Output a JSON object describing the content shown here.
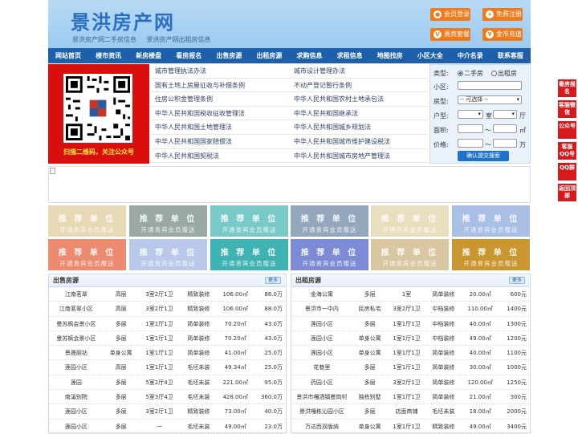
{
  "header": {
    "logo": "景洪房产网",
    "sub_links": [
      "景洪房产网二手房信息",
      "景洪房产网出租房信息"
    ],
    "buttons": [
      {
        "label": "会员登录",
        "icon": "user-icon"
      },
      {
        "label": "免费注册",
        "icon": "register-icon"
      },
      {
        "label": "贵宾套餐",
        "icon": "vip-icon"
      },
      {
        "label": "金币充值",
        "icon": "coin-icon"
      }
    ]
  },
  "nav": [
    "网站首页",
    "楼市资讯",
    "新房楼盘",
    "看房报名",
    "出售房源",
    "出租房源",
    "求购信息",
    "求租信息",
    "地图找房",
    "小区大全",
    "中介名录",
    "联系客服"
  ],
  "qr": {
    "caption": "扫描二维码，关注公众号"
  },
  "laws": [
    [
      "城市管理执法办法",
      "城市设计管理办法"
    ],
    [
      "国有土地上房屋征收与补偿条例",
      "不动产登记暂行条例"
    ],
    [
      "住房公积金管理条例",
      "中华人民共和国农村土地承包法"
    ],
    [
      "中华人民共和国税收征收管理法",
      "中华人民共和国继承法"
    ],
    [
      "中华人民共和国土地管理法",
      "中华人民共和国城乡规划法"
    ],
    [
      "中华人民共和国国家赔偿法",
      "中华人民共和国城市维护建设税法"
    ],
    [
      "中华人民共和国契税法",
      "中华人民共和国城市房地产管理法"
    ]
  ],
  "search": {
    "type_label": "类型:",
    "type_options": [
      "二手房",
      "出租房"
    ],
    "district_label": "小区:",
    "housetype_label": "房型:",
    "housetype_value": "-- 可选择 --",
    "layout_label": "户型:",
    "room_unit": "室",
    "hall_unit": "厅",
    "area_label": "面积:",
    "area_sep": "～",
    "area_unit": "㎡",
    "price_label": "价格:",
    "price_sep": "～",
    "price_unit": "万",
    "submit_label": "确认提交搜索"
  },
  "ads": {
    "title": "推 荐 单 位",
    "subtitle": "开通贵宾会员赠送",
    "colors": [
      "#e6d9b3",
      "#9aa8a6",
      "#7ac9c9",
      "#95a7bd",
      "#e9dfbf",
      "#a9bfe6",
      "#ee8a6f",
      "#b9c9ec",
      "#3fb3b3",
      "#7d8bd6",
      "#d9c7a1",
      "#c9962f"
    ]
  },
  "sale": {
    "title": "出售房源",
    "more": "更多",
    "rows": [
      [
        "江南茗翠",
        "高层",
        "3室2厅1卫",
        "精致装修",
        "106.00㎡",
        "88.0万"
      ],
      [
        "江南茗翠小区",
        "高层",
        "3室2厅1卫",
        "精致装修",
        "106.00㎡",
        "88.0万"
      ],
      [
        "曼苏枫会景小区",
        "多层",
        "1室1厅1卫",
        "简单装修",
        "70.20㎡",
        "43.0万"
      ],
      [
        "曼苏枫会景小区",
        "多层",
        "1室1厅1卫",
        "简单装修",
        "70.20㎡",
        "43.0万"
      ],
      [
        "景晟丽钻",
        "单身公寓",
        "1室1厅1卫",
        "简单装修",
        "41.00㎡",
        "25.0万"
      ],
      [
        "莲园小区",
        "高层",
        "1室1厅1卫",
        "毛坯未装",
        "49.34㎡",
        "25.0万"
      ],
      [
        "莲园",
        "多层",
        "5室2厅4卫",
        "毛坯未装",
        "221.00㎡",
        "95.0万"
      ],
      [
        "南溪别院",
        "多层",
        "5室3厅4卫",
        "毛坯未装",
        "428.00㎡",
        "360.0万"
      ],
      [
        "莲园小区",
        "多层",
        "3室2厅1卫",
        "精致装修",
        "73.00㎡",
        "40.0万"
      ],
      [
        "莲园小区",
        "多层",
        "一",
        "毛坯未装",
        "49.00㎡",
        "23.0万"
      ]
    ]
  },
  "rent": {
    "title": "出租房源",
    "more": "更多",
    "rows": [
      [
        "金海公寓",
        "多层",
        "1室",
        "简单装修",
        "20.00㎡",
        "600元"
      ],
      [
        "景洪市一中内",
        "民房私宅",
        "3室2厅1卫",
        "中档装修",
        "110.00㎡",
        "1400元"
      ],
      [
        "莲园小区",
        "多层",
        "1室1厅1卫",
        "中档装修",
        "40.00㎡",
        "1300元"
      ],
      [
        "莲园小区",
        "单身公寓",
        "1室1厅1卫",
        "中档装修",
        "49.00㎡",
        "1200元"
      ],
      [
        "莲园小区",
        "单身公寓",
        "1室1厅1卫",
        "简单装修",
        "40.00㎡",
        "1100元"
      ],
      [
        "花巷里",
        "多层",
        "1室1厅1卫",
        "简单装修",
        "30.00㎡",
        "1000元"
      ],
      [
        "药园小区",
        "多层",
        "3室2厅1卫",
        "简单装修",
        "120.00㎡",
        "1250元"
      ],
      [
        "景洪市嘎洒镇曼岗村",
        "独栋别墅",
        "1室1厅1卫",
        "简单装修",
        "21.00㎡",
        "300元"
      ],
      [
        "景洪嘎栋沁园小区",
        "多层",
        "店面商铺",
        "毛坯未装",
        "18.00㎡",
        "2000元"
      ],
      [
        "万达西双版纳",
        "单身公寓",
        "1室1厅1卫",
        "精致装修",
        "49.00㎡",
        "3400元"
      ]
    ]
  },
  "side": [
    "看房报名",
    "客服微信",
    "公众号",
    "客服QQ号",
    "QQ群",
    "返回顶部"
  ]
}
